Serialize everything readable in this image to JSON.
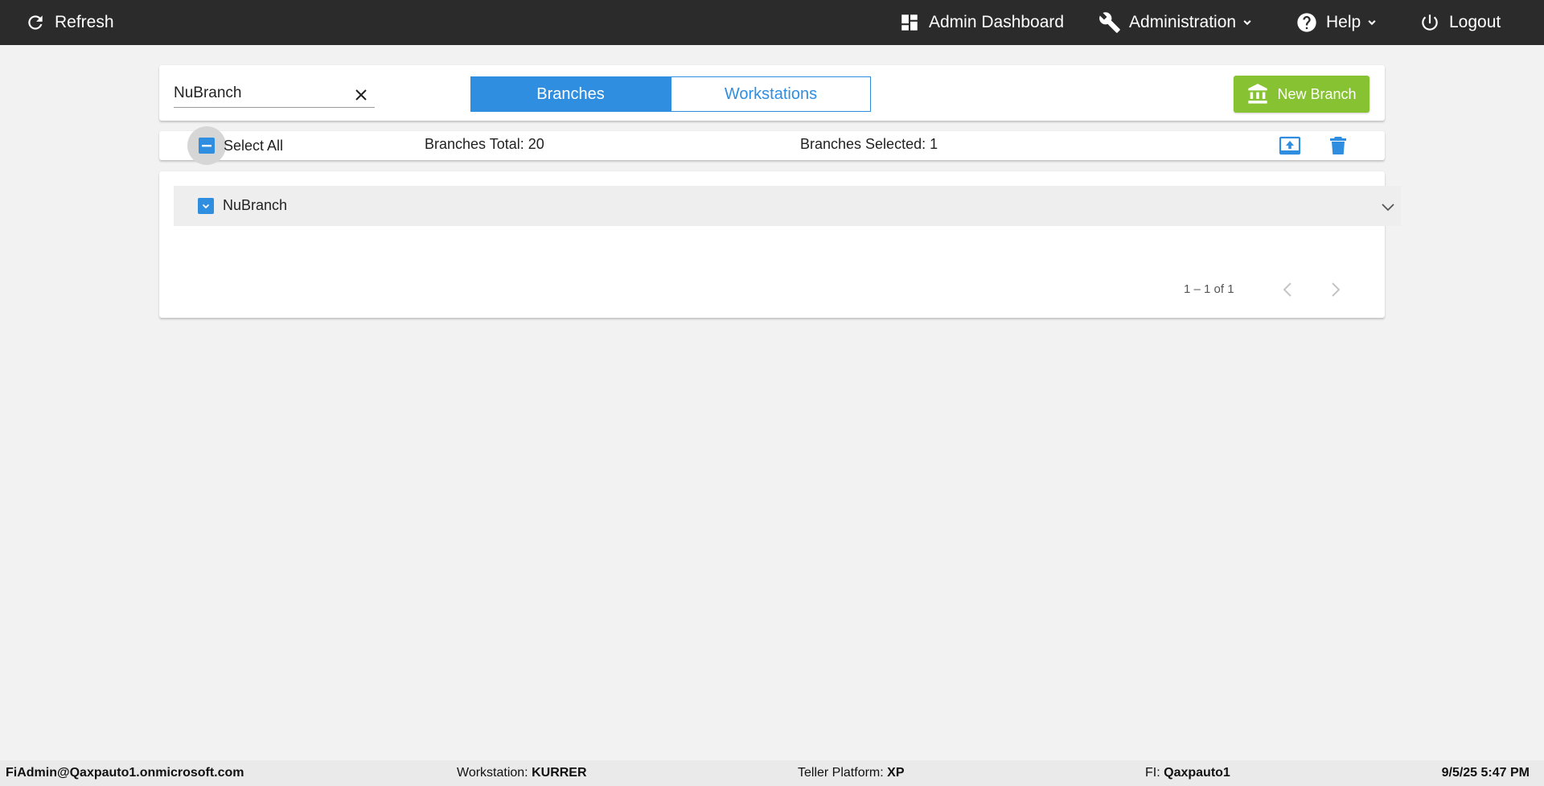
{
  "nav": {
    "refresh": "Refresh",
    "admin_dashboard": "Admin Dashboard",
    "administration": "Administration",
    "help": "Help",
    "logout": "Logout"
  },
  "toolbar": {
    "search_value": "NuBranch",
    "tabs": [
      {
        "label": "Branches",
        "active": true
      },
      {
        "label": "Workstations",
        "active": false
      }
    ],
    "new_branch_label": "New Branch"
  },
  "selection_bar": {
    "select_all_label": "Select All",
    "branches_total": "Branches Total: 20",
    "branches_selected": "Branches Selected: 1"
  },
  "list": {
    "items": [
      {
        "label": "NuBranch",
        "selected": true
      }
    ],
    "range_label": "1 – 1 of 1"
  },
  "footer": {
    "user": "FiAdmin@Qaxpauto1.onmicrosoft.com",
    "workstation_label": "Workstation:",
    "workstation_value": "KURRER",
    "teller_platform_label": "Teller Platform:",
    "teller_platform_value": "XP",
    "fi_label": "FI:",
    "fi_value": "Qaxpauto1",
    "datetime": "9/5/25 5:47 PM"
  },
  "colors": {
    "nav_bg": "#2b2b2b",
    "accent_blue": "#2f8ee0",
    "new_branch_green": "#86c232",
    "page_bg": "#f2f2f2"
  },
  "icons": [
    "refresh-icon",
    "dashboard-icon",
    "wrench-icon",
    "help-icon",
    "power-icon",
    "bank-icon",
    "clear-icon",
    "upload-icon",
    "trash-icon",
    "chevron-down-icon",
    "chevron-left-icon",
    "chevron-right-icon"
  ]
}
